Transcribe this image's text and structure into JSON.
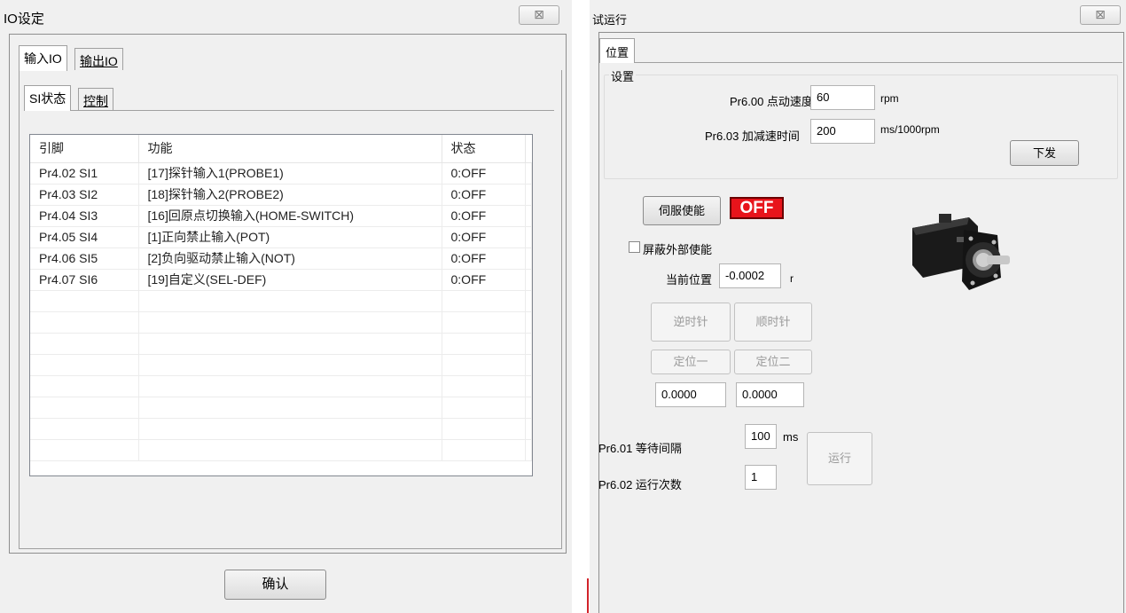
{
  "io_window": {
    "title": "IO设定",
    "close_glyph": "⊠",
    "tabs": [
      "输入IO",
      "输出IO"
    ],
    "sub_tabs": [
      "SI状态",
      "控制"
    ],
    "table": {
      "headers": [
        "引脚",
        "功能",
        "状态"
      ],
      "rows": [
        [
          "Pr4.02 SI1",
          "[17]探针输入1(PROBE1)",
          "0:OFF"
        ],
        [
          "Pr4.03 SI2",
          "[18]探针输入2(PROBE2)",
          "0:OFF"
        ],
        [
          "Pr4.04 SI3",
          "[16]回原点切换输入(HOME-SWITCH)",
          "0:OFF"
        ],
        [
          "Pr4.05 SI4",
          "[1]正向禁止输入(POT)",
          "0:OFF"
        ],
        [
          "Pr4.06 SI5",
          "[2]负向驱动禁止输入(NOT)",
          "0:OFF"
        ],
        [
          "Pr4.07 SI6",
          "[19]自定义(SEL-DEF)",
          "0:OFF"
        ]
      ]
    },
    "confirm_label": "确认"
  },
  "trial_window": {
    "title": "试运行",
    "close_glyph": "⊠",
    "tab": "位置",
    "group_title": "设置",
    "jog_speed_label": "Pr6.00 点动速度",
    "jog_speed_value": "60",
    "jog_speed_unit": "rpm",
    "accel_label": "Pr6.03 加减速时间",
    "accel_value": "200",
    "accel_unit": "ms/1000rpm",
    "download_label": "下发",
    "servo_enable_label": "伺服使能",
    "servo_state": "OFF",
    "servo_state_color": "#e8141b",
    "mask_enable_label": "屏蔽外部使能",
    "current_pos_label": "当前位置",
    "current_pos_value": "-0.0002",
    "current_pos_unit": "r",
    "ccw_label": "逆时针",
    "cw_label": "顺时针",
    "pos1_label": "定位一",
    "pos2_label": "定位二",
    "pos1_value": "0.0000",
    "pos2_value": "0.0000",
    "wait_label": "Pr6.01 等待间隔",
    "wait_value": "100",
    "wait_unit": "ms",
    "run_label": "运行",
    "count_label": "Pr6.02 运行次数",
    "count_value": "1"
  }
}
